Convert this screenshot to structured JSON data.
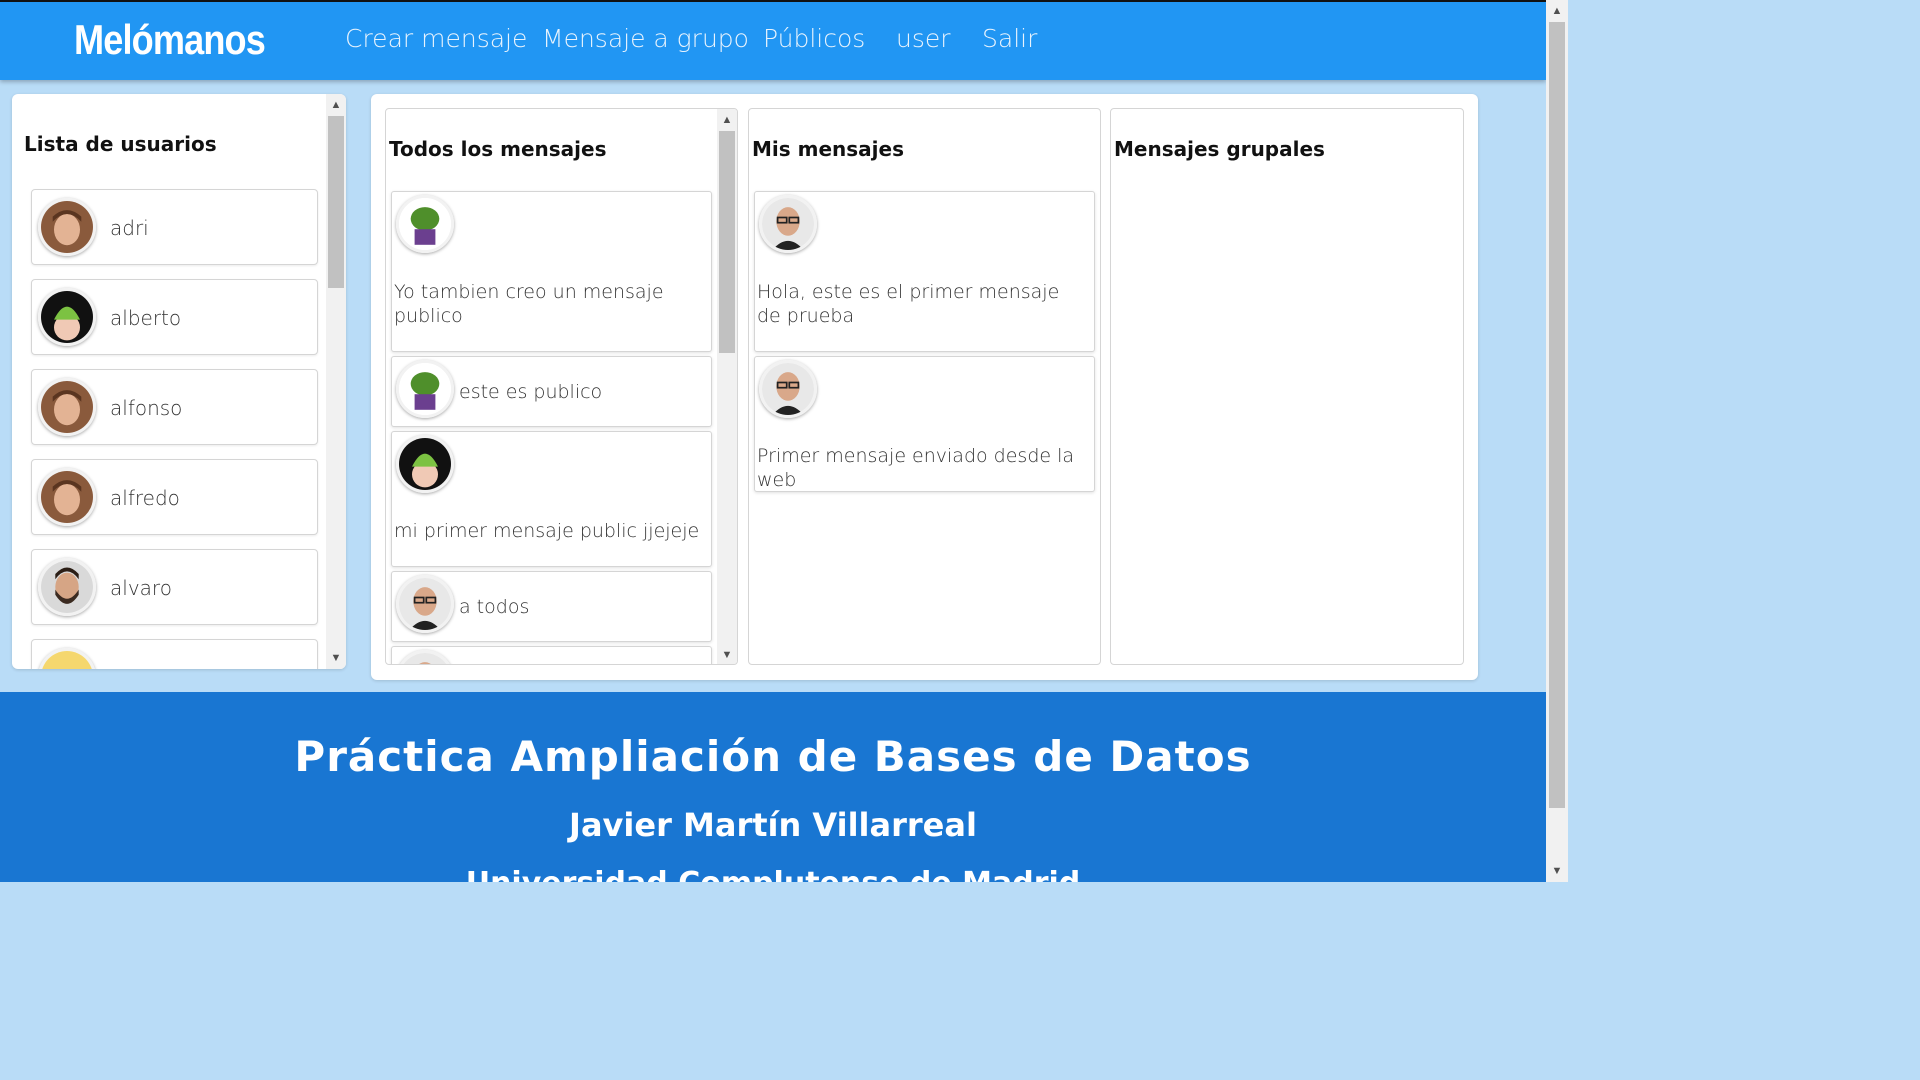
{
  "nav": {
    "brand": "Melómanos",
    "links": [
      "Crear mensaje",
      "Mensaje a grupo",
      "Públicos",
      "user",
      "Salir"
    ]
  },
  "users": {
    "title": "Lista de usuarios",
    "items": [
      {
        "name": "adri",
        "avatar": "young-man-avatar"
      },
      {
        "name": "alberto",
        "avatar": "baby-green-hat-avatar"
      },
      {
        "name": "alfonso",
        "avatar": "young-man-avatar"
      },
      {
        "name": "alfredo",
        "avatar": "young-man-avatar"
      },
      {
        "name": "alvaro",
        "avatar": "bearded-man-avatar"
      },
      {
        "name": "",
        "avatar": "cartoon-avatar"
      }
    ]
  },
  "columns": {
    "todos": {
      "title": "Todos los mensajes",
      "messages": [
        {
          "text": "Yo tambien creo un mensaje publico",
          "avatar": "hulk-avatar"
        },
        {
          "text": "este es publico",
          "avatar": "hulk-avatar"
        },
        {
          "text": "mi primer mensaje public jjejeje",
          "avatar": "baby-green-hat-avatar"
        },
        {
          "text": "a todos",
          "avatar": "man-glasses-avatar"
        }
      ]
    },
    "mis": {
      "title": "Mis mensajes",
      "messages": [
        {
          "text": "Hola, este es el primer mensaje de prueba",
          "avatar": "man-glasses-avatar"
        },
        {
          "text": "Primer mensaje enviado desde la web",
          "avatar": "man-glasses-avatar"
        }
      ]
    },
    "grupales": {
      "title": "Mensajes grupales",
      "messages": []
    }
  },
  "footer": {
    "title": "Práctica Ampliación de Bases de Datos",
    "author": "Javier Martín Villarreal",
    "university": "Universidad Complutense de Madrid"
  },
  "colors": {
    "navbar": "#2196f3",
    "background": "#b9dcf7",
    "footer": "#1976d2"
  }
}
